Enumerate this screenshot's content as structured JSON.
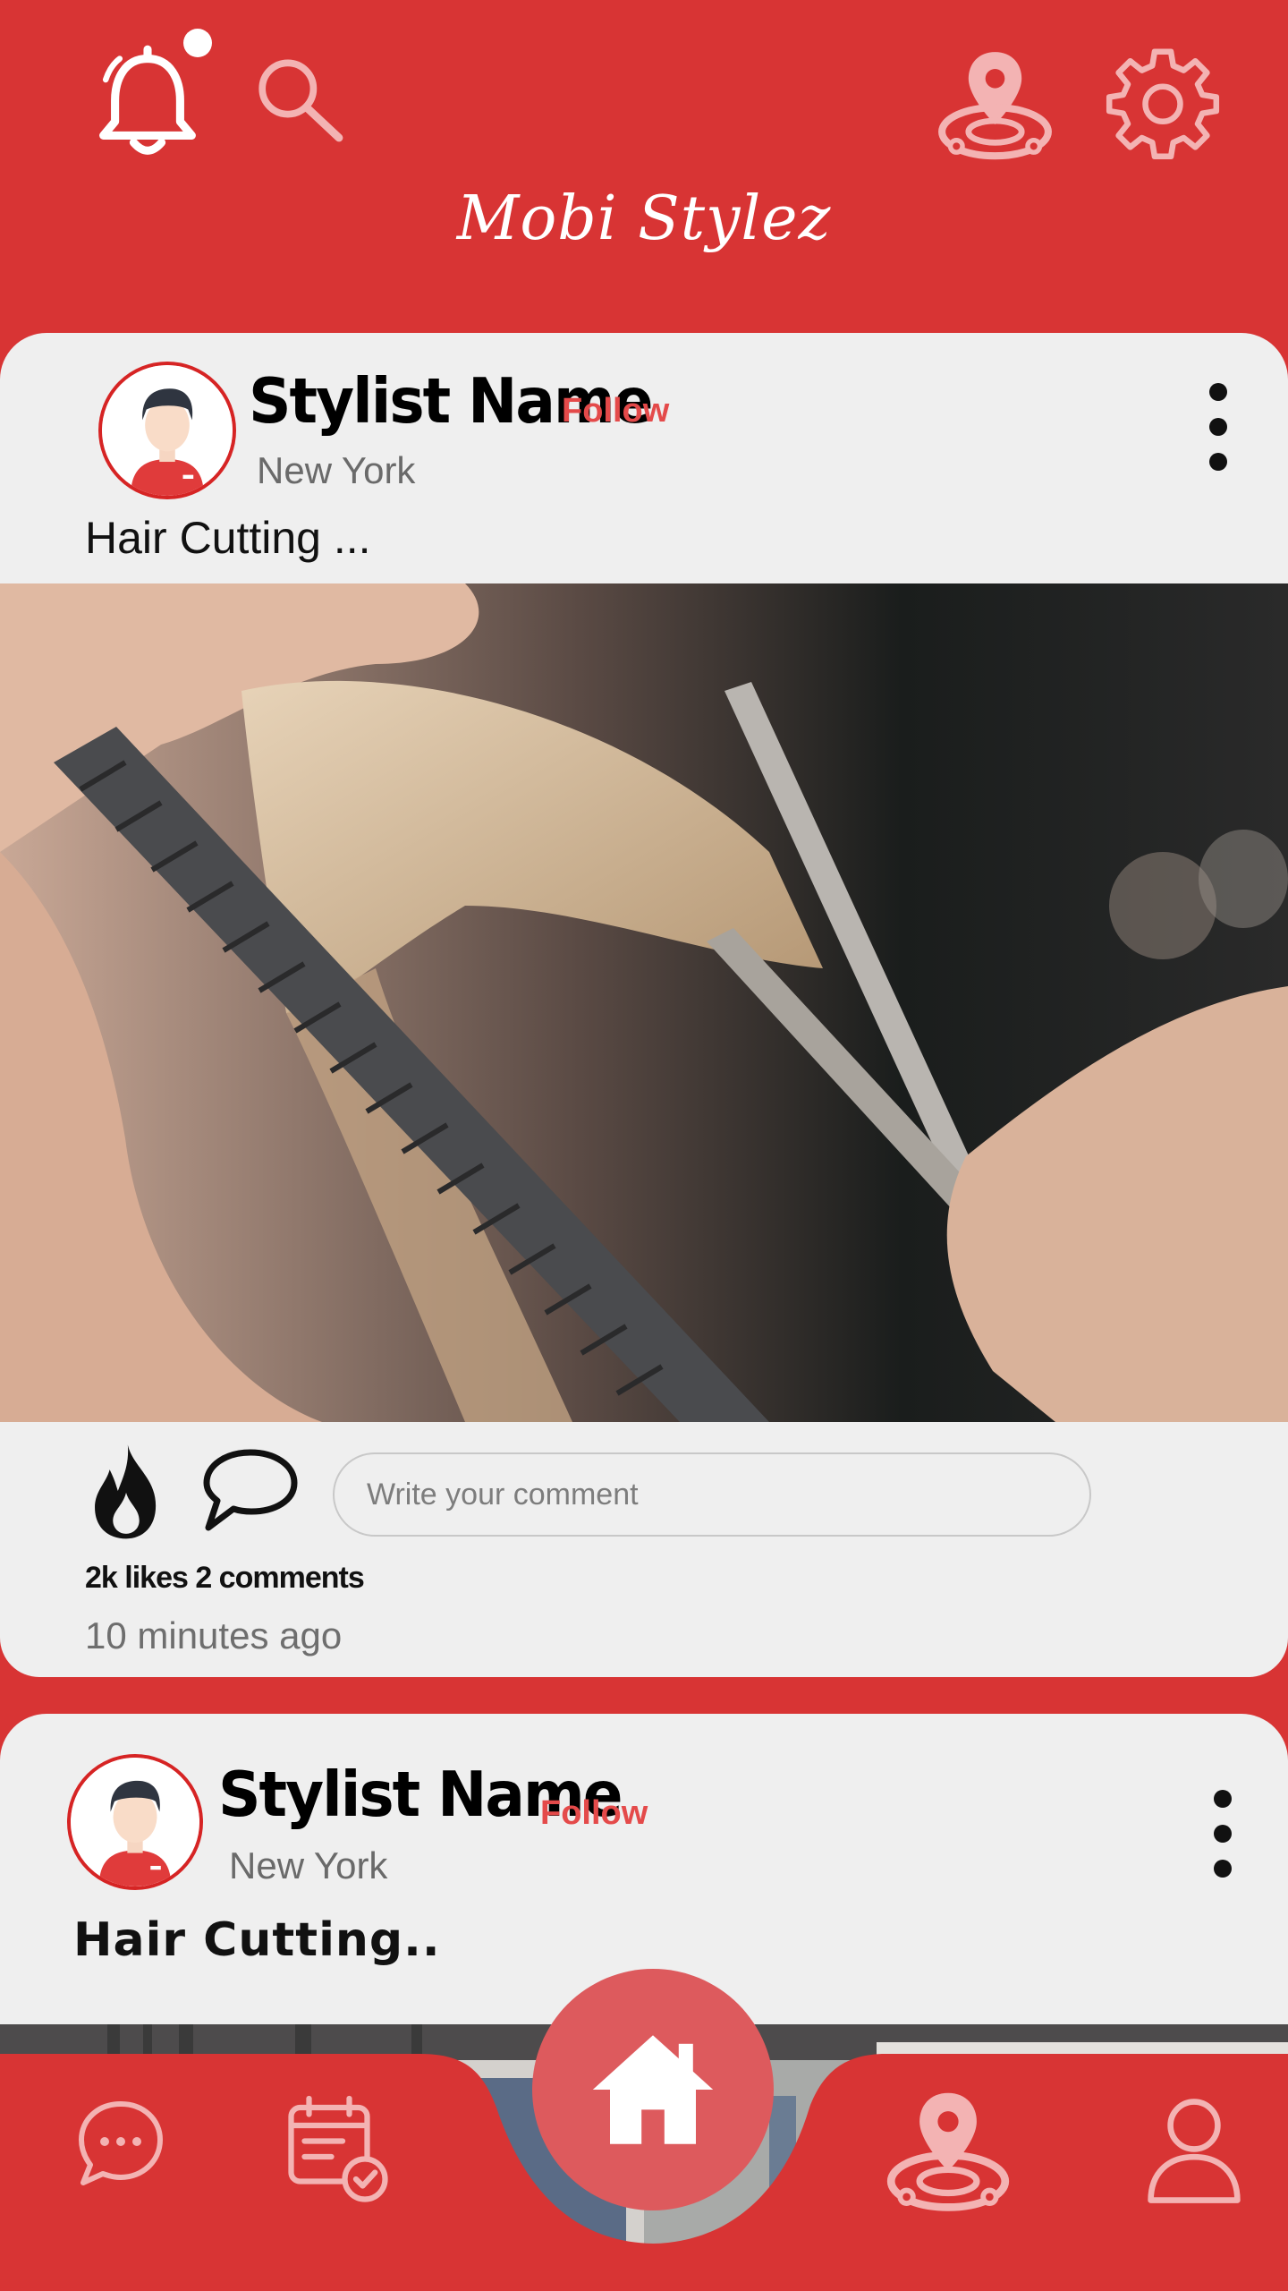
{
  "app": {
    "title": "Mobi Stylez"
  },
  "header": {
    "icons": [
      "bell-icon",
      "search-icon",
      "location-icon",
      "gear-icon"
    ],
    "has_notification": true
  },
  "posts": [
    {
      "stylist_name": "Stylist Name",
      "follow_label": "Follow",
      "city": "New York",
      "caption": "Hair Cutting ...",
      "comment_placeholder": "Write your comment",
      "stats": "2k likes 2 comments",
      "time_ago": "10 minutes ago"
    },
    {
      "stylist_name": "Stylist Name",
      "follow_label": "Follow",
      "city": "New York",
      "caption": "Hair Cutting.."
    }
  ],
  "bottom_nav": {
    "items": [
      "chat-icon",
      "calendar-check-icon",
      "home-icon",
      "location-icon",
      "user-icon"
    ],
    "active": "home-icon"
  },
  "colors": {
    "primary": "#d83434",
    "card": "#efefef",
    "follow": "#e44a4a",
    "home_button": "#dd5a5d"
  }
}
